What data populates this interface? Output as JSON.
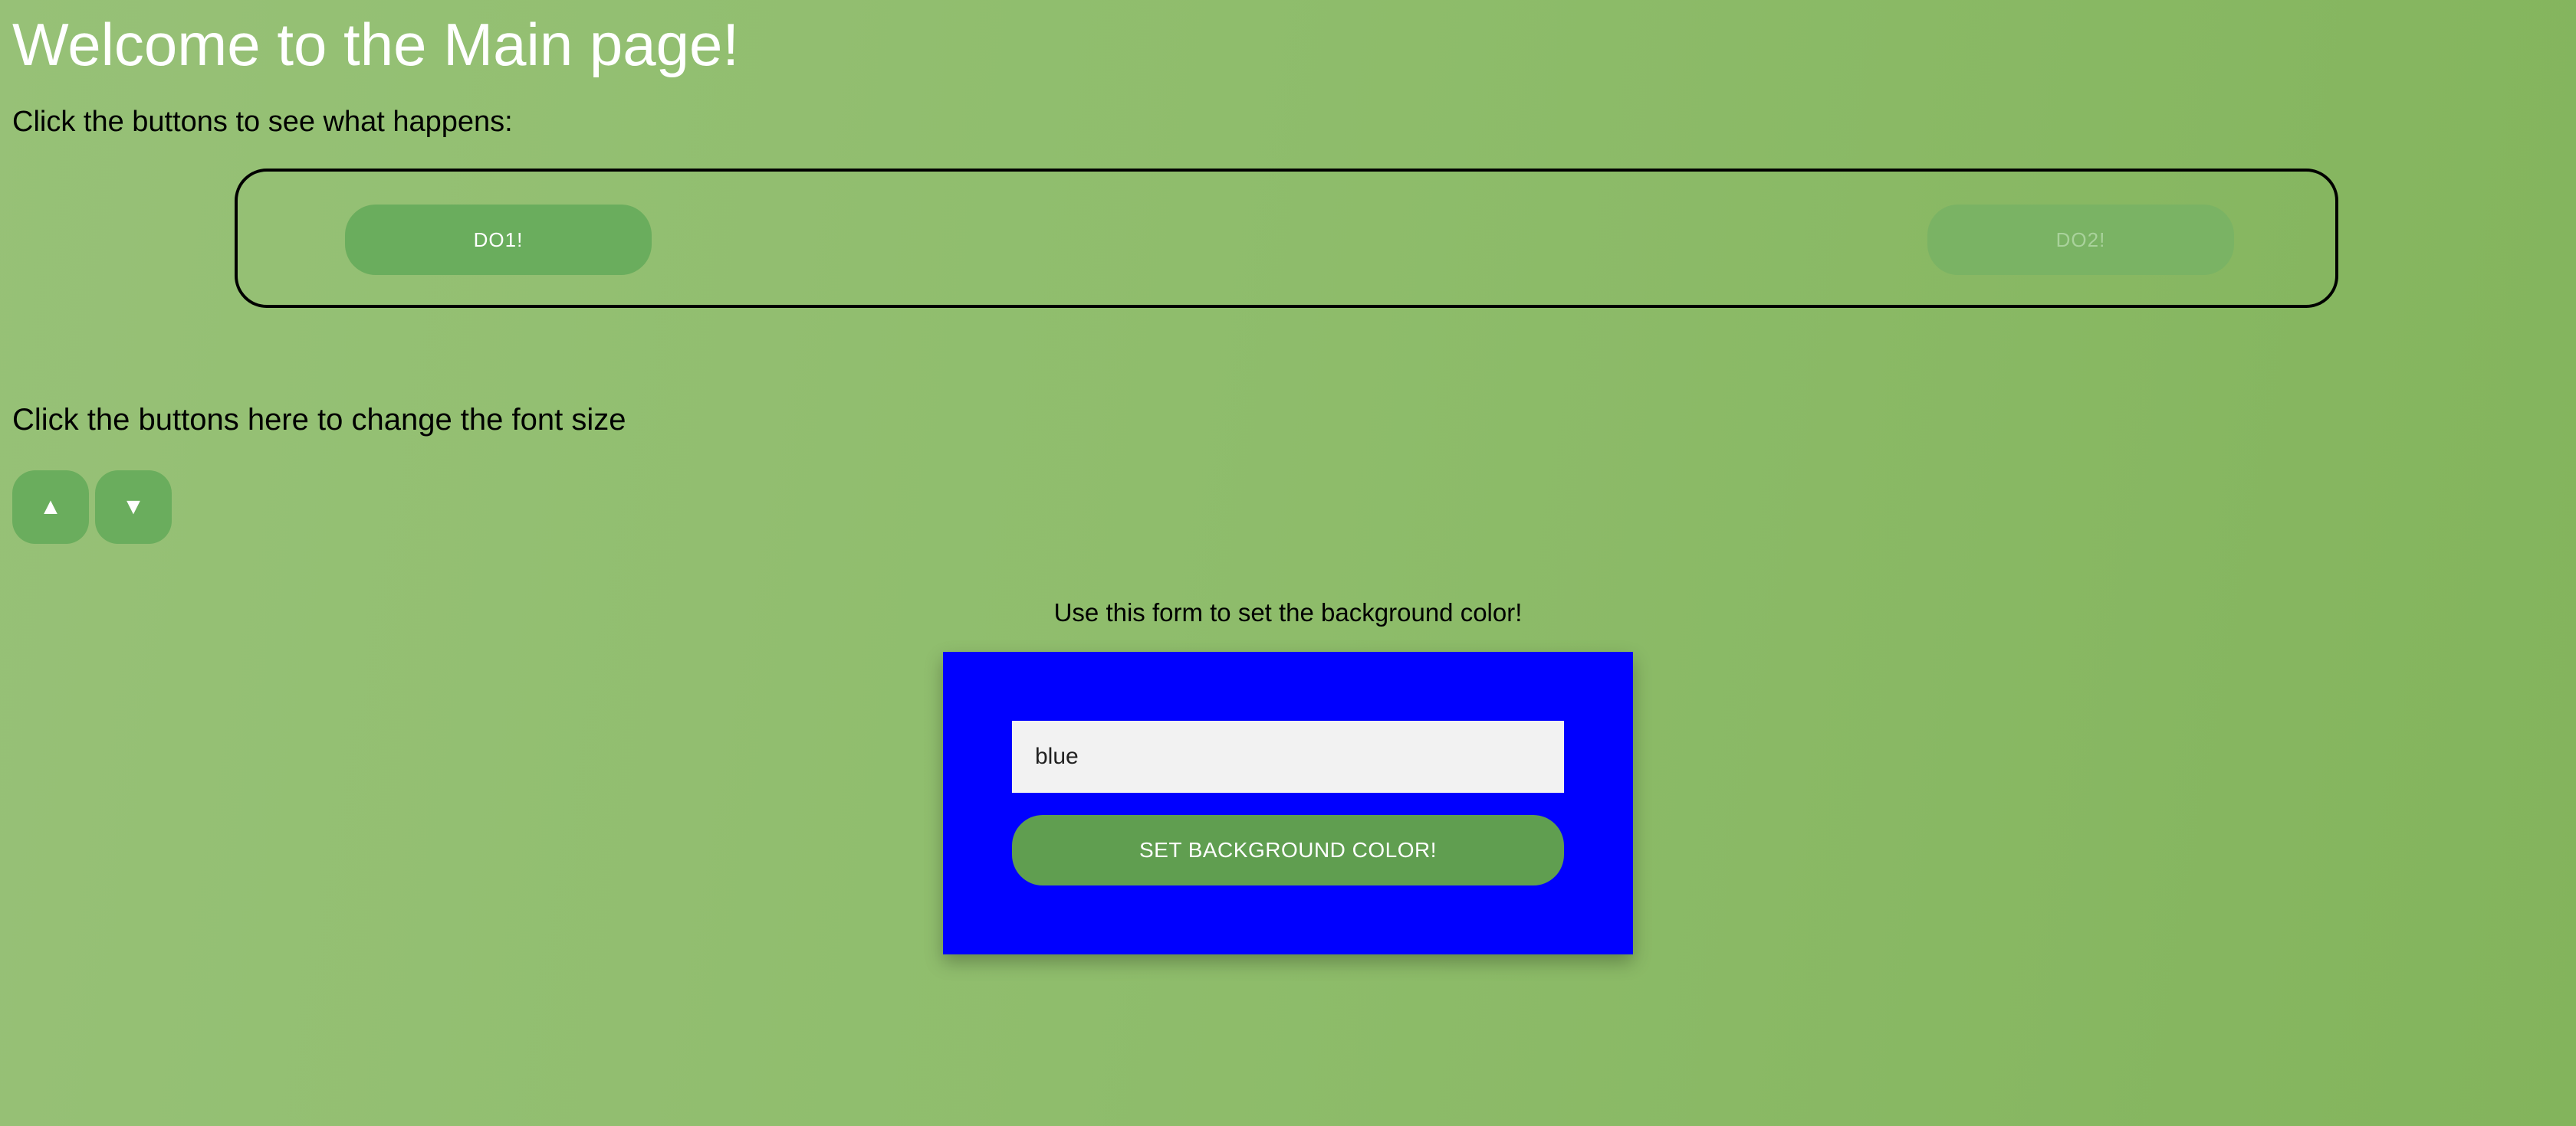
{
  "page": {
    "title": "Welcome to the Main page!",
    "intro": "Click the buttons to see what happens:"
  },
  "action_buttons": {
    "do1_label": "DO1!",
    "do2_label": "DO2!"
  },
  "font_controls": {
    "text": "Click the buttons here to change the font size",
    "increase_icon": "▲",
    "decrease_icon": "▼"
  },
  "color_form": {
    "caption": "Use this form to set the background color!",
    "input_value": "blue",
    "submit_label": "SET BACKGROUND COLOR!",
    "form_background": "#0000ff"
  },
  "colors": {
    "page_gradient_start": "#97c177",
    "page_gradient_end": "#83b45c",
    "button_green": "#6aad5d",
    "submit_green": "#609e50"
  }
}
